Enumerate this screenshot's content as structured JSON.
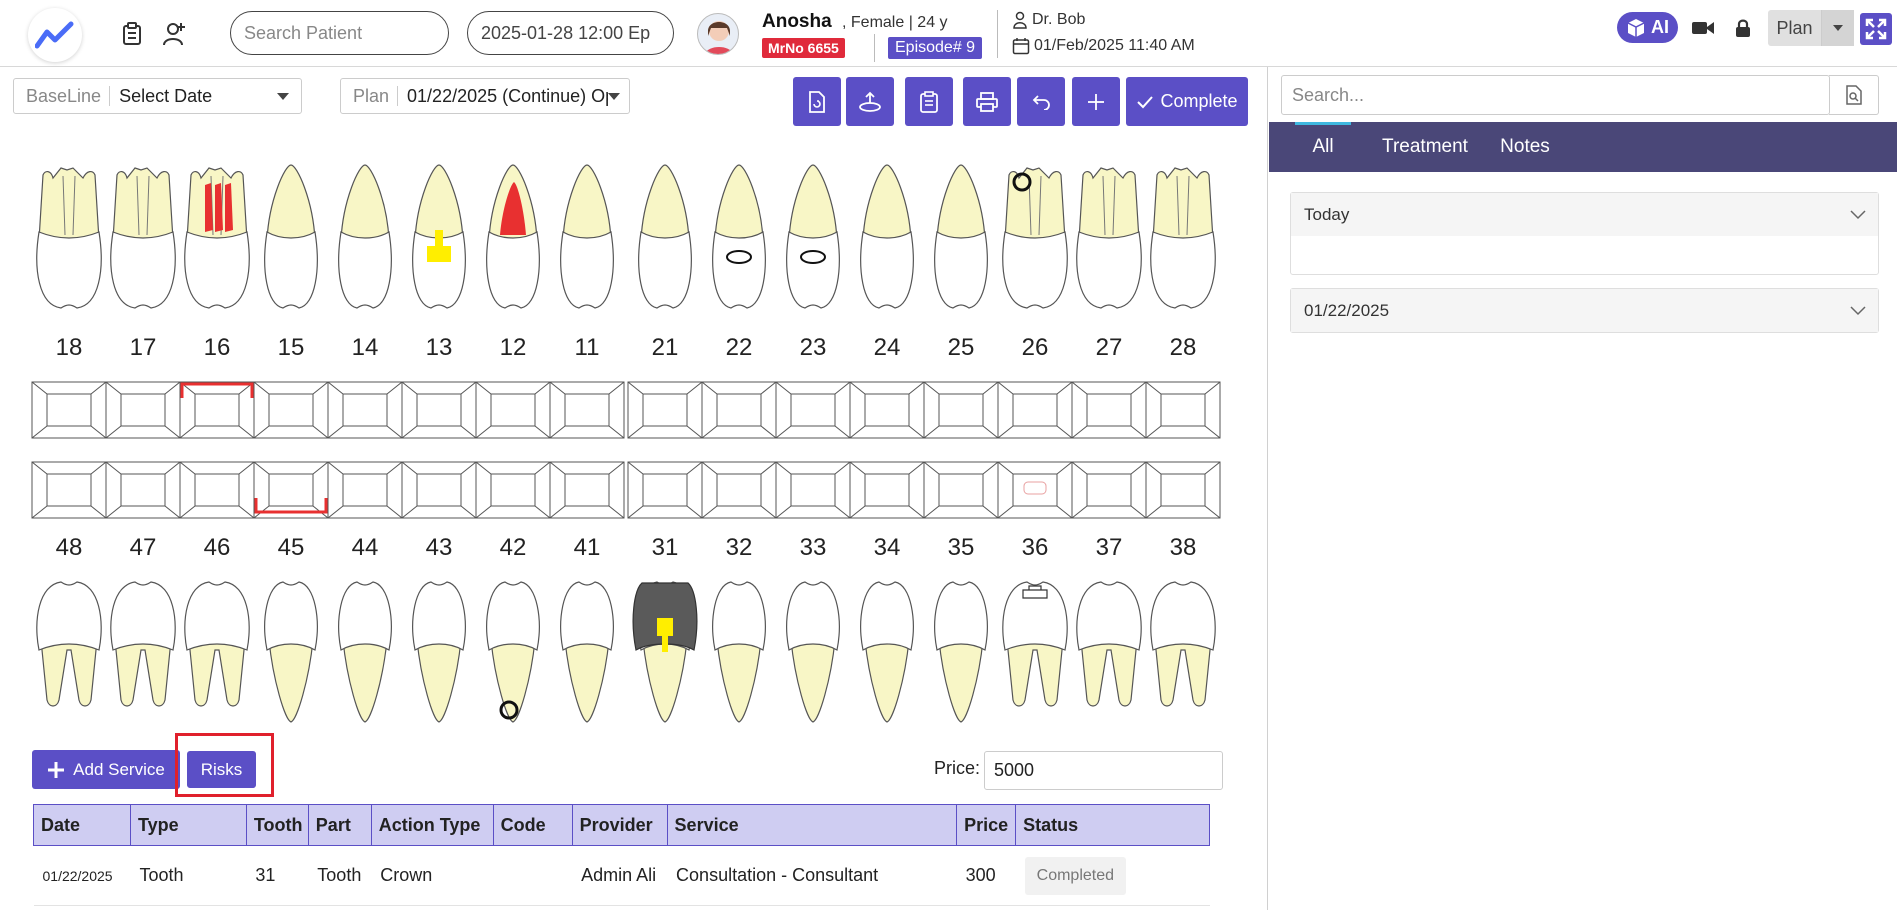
{
  "header": {
    "search_placeholder": "Search Patient",
    "datetime_value": "2025-01-28 12:00 Ep",
    "patient_name": "Anosha",
    "patient_meta": ", Female | 24 y",
    "mrno": "MrNo 6655",
    "episode": "Episode# 9",
    "doctor": "Dr. Bob",
    "visit_datetime": "01/Feb/2025 11:40 AM",
    "ai_label": "AI",
    "plan_label": "Plan"
  },
  "toolbar": {
    "baseline_prefix": "BaseLine",
    "baseline_value": "Select Date",
    "plan_prefix": "Plan",
    "plan_value": "01/22/2025 (Continue) Op",
    "complete_label": "Complete"
  },
  "chart": {
    "upper_numbers": [
      "18",
      "17",
      "16",
      "15",
      "14",
      "13",
      "12",
      "11",
      "21",
      "22",
      "23",
      "24",
      "25",
      "26",
      "27",
      "28"
    ],
    "lower_numbers": [
      "48",
      "47",
      "46",
      "45",
      "44",
      "43",
      "42",
      "41",
      "31",
      "32",
      "33",
      "34",
      "35",
      "36",
      "37",
      "38"
    ]
  },
  "actions": {
    "add_service_label": "Add Service",
    "risks_label": "Risks",
    "price_label": "Price:",
    "price_value": "5000"
  },
  "table": {
    "headers": [
      "Date",
      "Type",
      "Tooth",
      "Part",
      "Action Type",
      "Code",
      "Provider",
      "Service",
      "Price",
      "Status"
    ],
    "rows": [
      {
        "date": "01/22/2025",
        "type": "Tooth",
        "tooth": "31",
        "part": "Tooth",
        "action_type": "Crown",
        "code": "",
        "provider": "Admin Ali",
        "service": "Consultation - Consultant",
        "price": "300",
        "status": "Completed"
      }
    ]
  },
  "right_panel": {
    "search_placeholder": "Search...",
    "tabs": [
      "All",
      "Treatment",
      "Notes"
    ],
    "sections": [
      "Today",
      "01/22/2025"
    ]
  },
  "colors": {
    "accent": "#5b4fc6",
    "tab_bar": "#4a4778",
    "danger": "#e02a3b",
    "tooth_root": "#f8f6c6",
    "highlight_yellow": "#ffee00",
    "highlight_red": "#e83030"
  }
}
